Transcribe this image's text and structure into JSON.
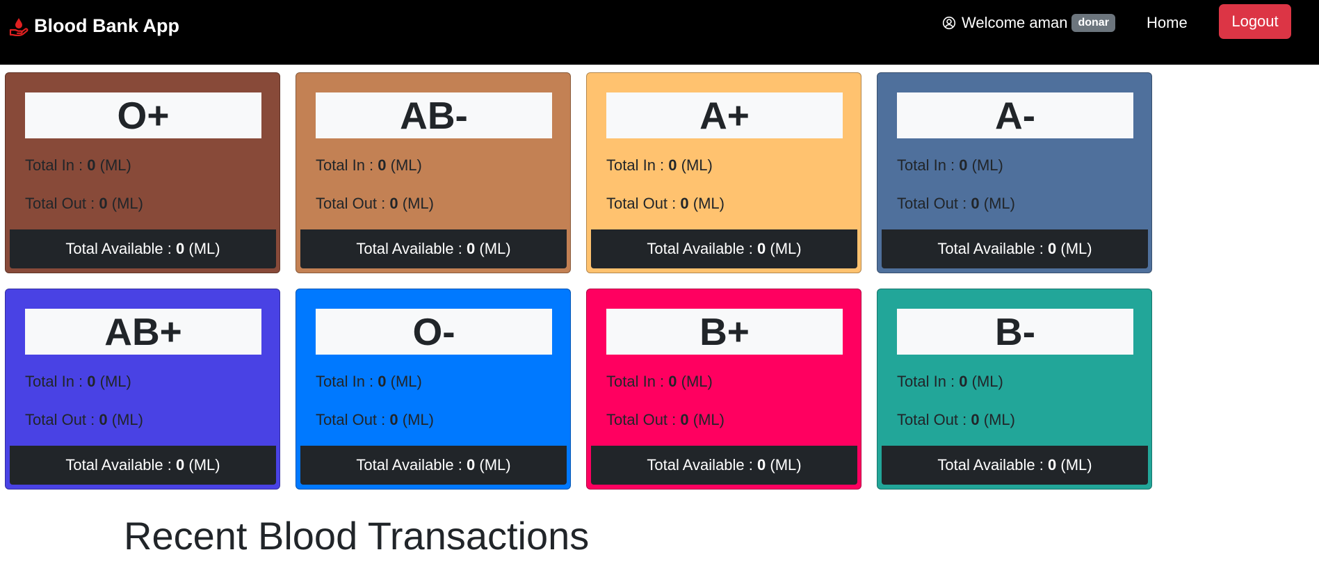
{
  "navbar": {
    "brand": "Blood Bank App",
    "welcome_prefix": "Welcome",
    "username": "aman",
    "role": "donar",
    "home": "Home",
    "logout": "Logout"
  },
  "labels": {
    "total_in": "Total In : ",
    "total_out": "Total Out : ",
    "total_available": "Total Available : ",
    "unit": " (ML)"
  },
  "cards": [
    {
      "group": "O+",
      "total_in": "0",
      "total_out": "0",
      "available": "0",
      "color": "#884a39"
    },
    {
      "group": "AB-",
      "total_in": "0",
      "total_out": "0",
      "available": "0",
      "color": "#c38154"
    },
    {
      "group": "A+",
      "total_in": "0",
      "total_out": "0",
      "available": "0",
      "color": "#ffc26f"
    },
    {
      "group": "A-",
      "total_in": "0",
      "total_out": "0",
      "available": "0",
      "color": "#4f709c"
    },
    {
      "group": "AB+",
      "total_in": "0",
      "total_out": "0",
      "available": "0",
      "color": "#4942e4"
    },
    {
      "group": "O-",
      "total_in": "0",
      "total_out": "0",
      "available": "0",
      "color": "#0079ff"
    },
    {
      "group": "B+",
      "total_in": "0",
      "total_out": "0",
      "available": "0",
      "color": "#ff0060"
    },
    {
      "group": "B-",
      "total_in": "0",
      "total_out": "0",
      "available": "0",
      "color": "#22a699"
    }
  ],
  "section_title": "Recent Blood Transactions"
}
